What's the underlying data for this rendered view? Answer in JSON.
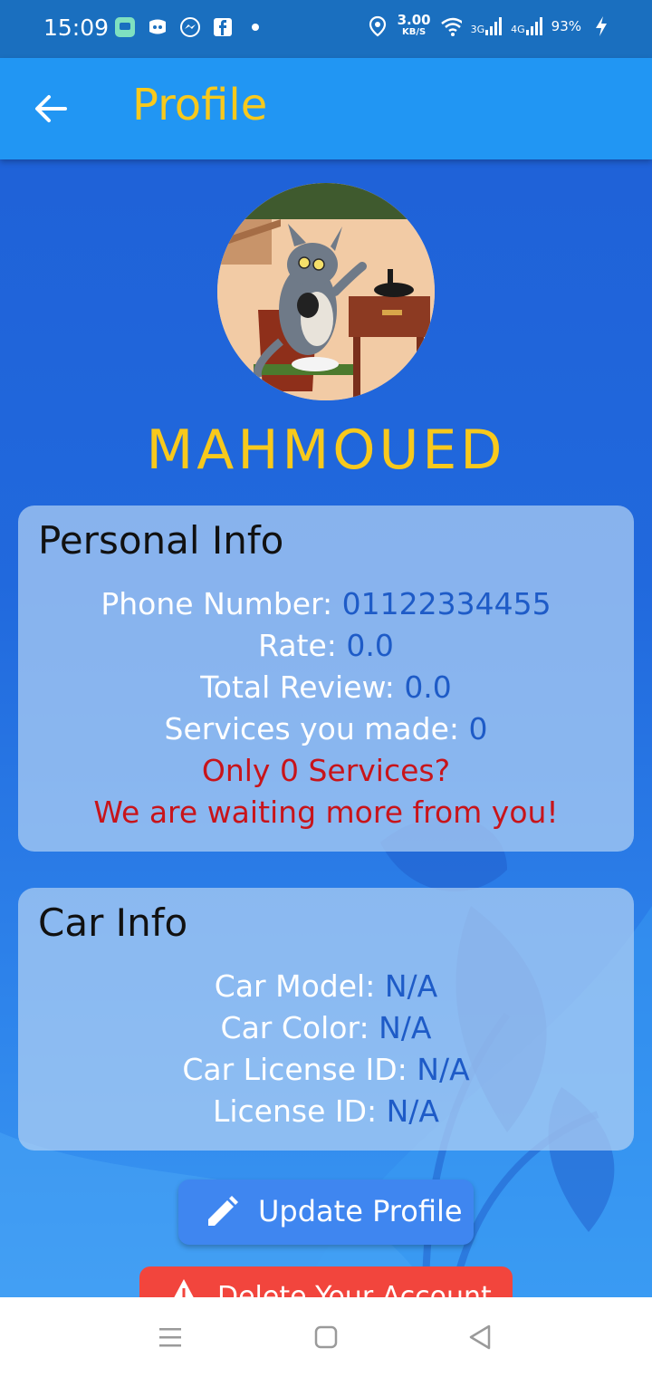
{
  "status_bar": {
    "time": "15:09",
    "speed_value": "3.00",
    "speed_unit": "KB/S",
    "network_3g": "3G",
    "network_4g": "4G",
    "battery": "93%"
  },
  "app_bar": {
    "title": "Profile"
  },
  "profile": {
    "name": "MAHMOUED"
  },
  "personal_info": {
    "title": "Personal Info",
    "phone_label": "Phone Number: ",
    "phone_value": "01122334455",
    "rate_label": "Rate: ",
    "rate_value": "0.0",
    "total_review_label": "Total Review: ",
    "total_review_value": "0.0",
    "services_label": "Services you made: ",
    "services_value": "0",
    "encourage_line1": "Only 0 Services?",
    "encourage_line2": "We are waiting more from you!"
  },
  "car_info": {
    "title": "Car Info",
    "model_label": "Car Model: ",
    "model_value": "N/A",
    "color_label": "Car Color: ",
    "color_value": "N/A",
    "car_license_label": "Car License ID: ",
    "car_license_value": "N/A",
    "license_label": "License ID: ",
    "license_value": "N/A"
  },
  "actions": {
    "update_label": "Update Profile",
    "delete_label": "Delete Your Account"
  },
  "colors": {
    "app_bar": "#2196f3",
    "accent_yellow": "#f8c91c",
    "value_blue": "#1e5bc7",
    "warning_red": "#c8141a",
    "delete_red": "#f2453d"
  }
}
